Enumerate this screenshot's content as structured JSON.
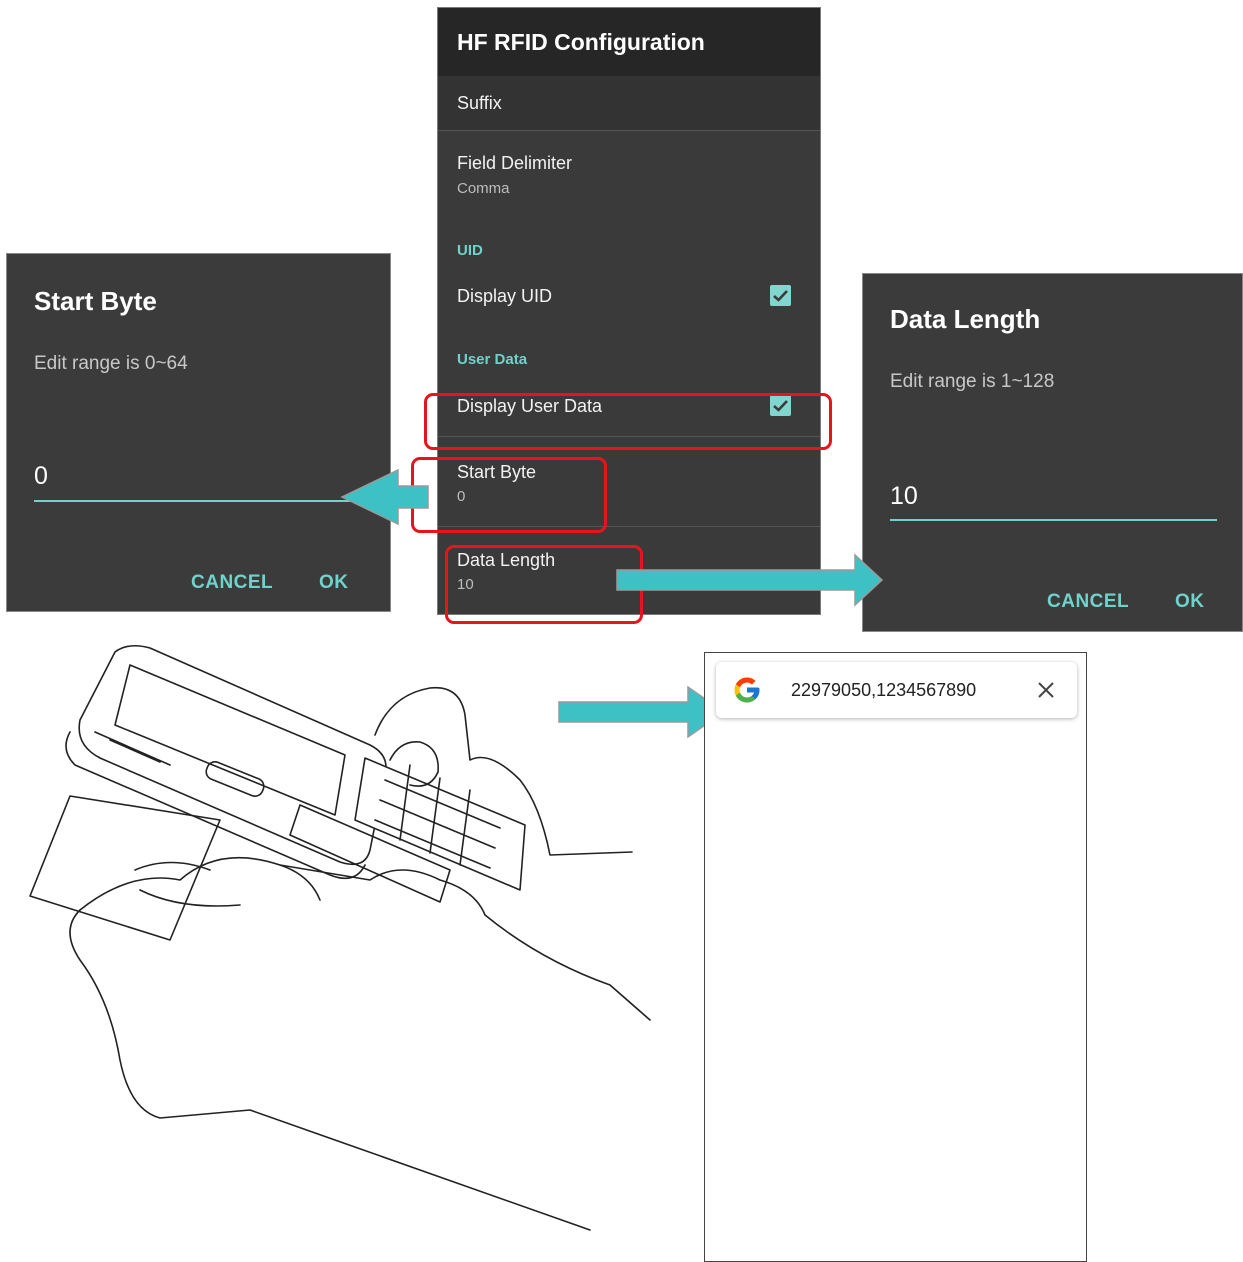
{
  "settings": {
    "title": "HF RFID Configuration",
    "suffix": "Suffix",
    "field_delimiter": {
      "title": "Field Delimiter",
      "value": "Comma"
    },
    "uid_category": "UID",
    "display_uid": {
      "title": "Display UID",
      "checked": true
    },
    "user_data_category": "User Data",
    "display_user_data": {
      "title": "Display User Data",
      "checked": true
    },
    "start_byte": {
      "title": "Start Byte",
      "value": "0"
    },
    "data_length": {
      "title": "Data Length",
      "value": "10"
    }
  },
  "start_byte_dialog": {
    "title": "Start Byte",
    "message": "Edit range is 0~64",
    "input_value": "0",
    "cancel": "CANCEL",
    "ok": "OK"
  },
  "data_length_dialog": {
    "title": "Data Length",
    "message": "Edit range is 1~128",
    "input_value": "10",
    "cancel": "CANCEL",
    "ok": "OK"
  },
  "search_result": {
    "text": "22979050,1234567890",
    "icon": "google-icon",
    "close_icon": "close-icon"
  },
  "colors": {
    "accent": "#6fd3cb",
    "arrow": "#3ec1c4",
    "highlight": "#e8141c",
    "panel": "#3a3a3a"
  }
}
